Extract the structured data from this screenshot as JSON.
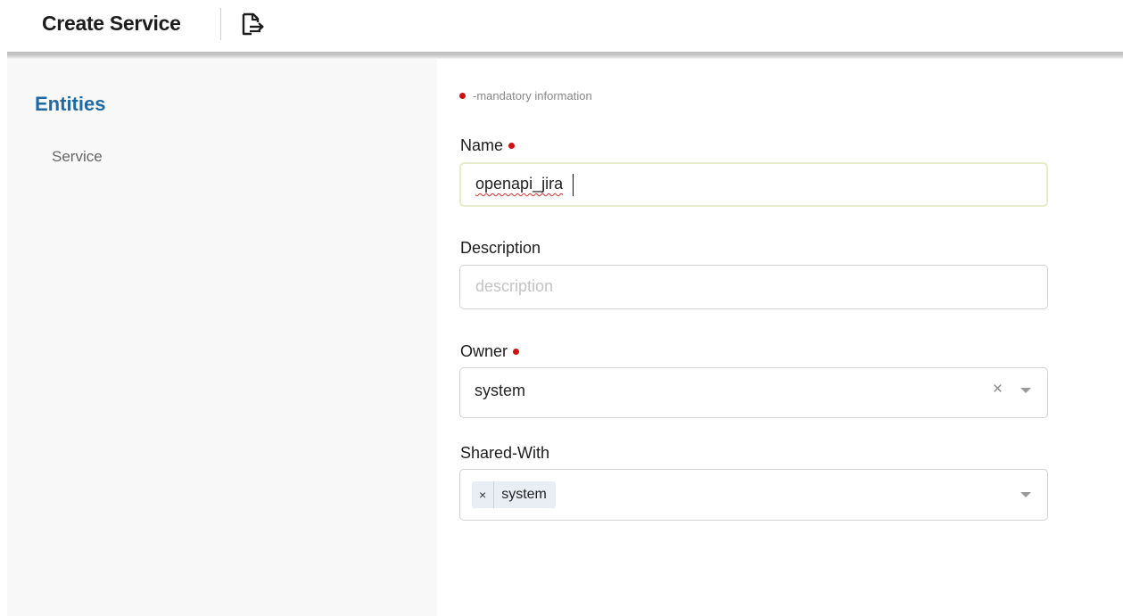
{
  "header": {
    "title": "Create Service",
    "export_icon": "export-file-icon"
  },
  "sidebar": {
    "heading": "Entities",
    "items": [
      {
        "label": "Service"
      }
    ]
  },
  "form": {
    "mandatory_note": "-mandatory information",
    "name": {
      "label": "Name",
      "value": "openapi_jira",
      "required": true
    },
    "description": {
      "label": "Description",
      "value": "",
      "placeholder": "description",
      "required": false
    },
    "owner": {
      "label": "Owner",
      "value": "system",
      "required": true
    },
    "shared_with": {
      "label": "Shared-With",
      "chips": [
        {
          "remove": "×",
          "label": "system"
        }
      ]
    }
  },
  "colors": {
    "accent": "#1f6aa5",
    "required_dot": "#cc1111",
    "focus_border": "#e7eccb"
  }
}
